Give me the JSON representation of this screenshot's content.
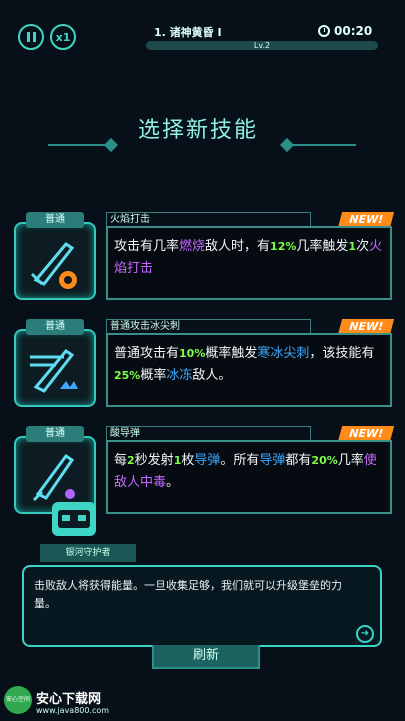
{
  "hud": {
    "speed_label": "x1",
    "stage_title": "1. 诸神黄昏 I",
    "level_label": "Lv.2",
    "timer": "00:20",
    "level_progress": 0.0
  },
  "header": {
    "title": "选择新技能"
  },
  "cards": [
    {
      "tag": "普通",
      "title": "火焰打击",
      "badge": "NEW!",
      "desc": [
        {
          "t": "攻击有几率",
          "c": ""
        },
        {
          "t": "燃烧",
          "c": "p"
        },
        {
          "t": "敌人时，有",
          "c": ""
        },
        {
          "t": "12%",
          "c": "g"
        },
        {
          "t": "几率触发",
          "c": ""
        },
        {
          "t": "1",
          "c": "g"
        },
        {
          "t": "次",
          "c": ""
        },
        {
          "t": "火焰打击",
          "c": "p"
        }
      ]
    },
    {
      "tag": "普通",
      "title": "普通攻击冰尖刺",
      "badge": "NEW!",
      "desc": [
        {
          "t": "普通攻击有",
          "c": ""
        },
        {
          "t": "10%",
          "c": "g"
        },
        {
          "t": "概率触发",
          "c": ""
        },
        {
          "t": "寒冰尖刺",
          "c": "b"
        },
        {
          "t": "，该技能有",
          "c": ""
        },
        {
          "t": "25%",
          "c": "g"
        },
        {
          "t": "概率",
          "c": ""
        },
        {
          "t": "冰冻",
          "c": "b"
        },
        {
          "t": "敌人。",
          "c": ""
        }
      ]
    },
    {
      "tag": "普通",
      "title": "酸导弹",
      "badge": "NEW!",
      "desc": [
        {
          "t": "每",
          "c": ""
        },
        {
          "t": "2",
          "c": "g"
        },
        {
          "t": "秒发射",
          "c": ""
        },
        {
          "t": "1",
          "c": "g"
        },
        {
          "t": "枚",
          "c": ""
        },
        {
          "t": "导弹",
          "c": "b"
        },
        {
          "t": "。所有",
          "c": ""
        },
        {
          "t": "导弹",
          "c": "b"
        },
        {
          "t": "都有",
          "c": ""
        },
        {
          "t": "20%",
          "c": "g"
        },
        {
          "t": "几率",
          "c": ""
        },
        {
          "t": "使敌人中毒",
          "c": "p"
        },
        {
          "t": "。",
          "c": ""
        }
      ]
    }
  ],
  "dialog": {
    "speaker": "银河守护者",
    "text": "击败敌人将获得能量。一旦收集足够，我们就可以升级堡垒的力量。"
  },
  "refresh_label": "刷新",
  "watermark": {
    "brand": "安心下载网",
    "url": "www.java800.com",
    "badge": "安心空间"
  }
}
